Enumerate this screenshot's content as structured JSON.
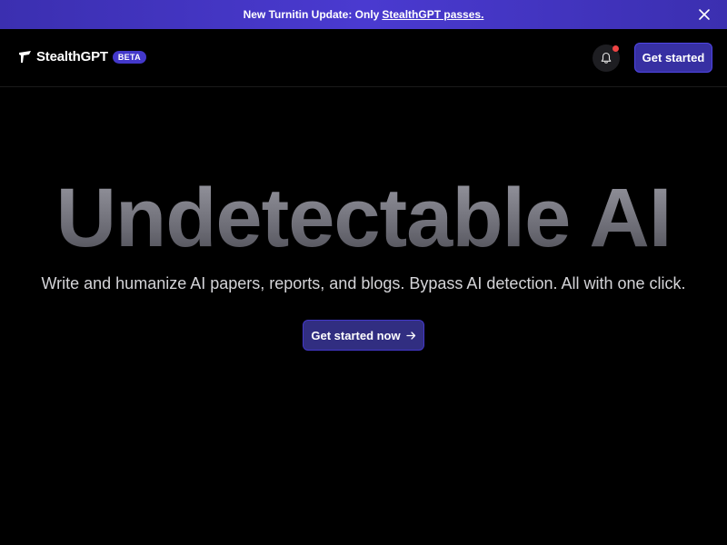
{
  "banner": {
    "text": "New Turnitin Update: Only",
    "link_text": "StealthGPT passes.",
    "close_icon": "close-icon"
  },
  "header": {
    "brand_name": "StealthGPT",
    "beta_label": "BETA",
    "get_started_label": "Get started",
    "icons": {
      "logo": "stealth-logo-icon",
      "bell": "bell-icon"
    }
  },
  "hero": {
    "title": "Undetectable AI",
    "subtitle": "Write and humanize AI papers, reports, and blogs. Bypass AI detection. All with one click.",
    "cta_label": "Get started now",
    "cta_icon": "arrow-right-icon"
  },
  "colors": {
    "banner_bg": "#3b2fb0",
    "accent": "#3730a3",
    "notification_dot": "#ef4444",
    "background": "#000000"
  }
}
